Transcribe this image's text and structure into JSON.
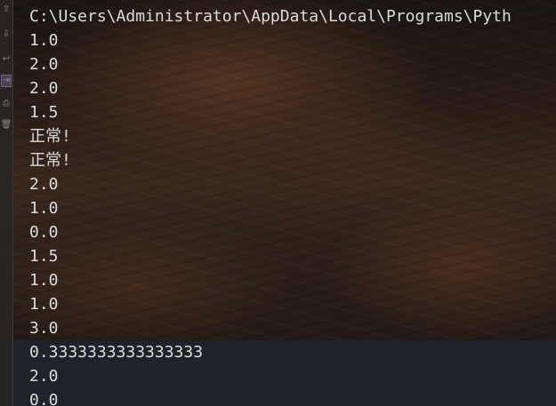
{
  "console": {
    "lines": [
      "C:\\Users\\Administrator\\AppData\\Local\\Programs\\Pyth",
      "1.0",
      "2.0",
      "2.0",
      "1.5",
      "正常!",
      "正常!",
      "2.0",
      "1.0",
      "0.0",
      "1.5",
      "1.0",
      "1.0",
      "3.0",
      "0.3333333333333333",
      "2.0",
      "0.0"
    ]
  },
  "gutter": {
    "icons": [
      {
        "name": "scroll-up-icon",
        "glyph": "⇧",
        "active": false
      },
      {
        "name": "scroll-down-icon",
        "glyph": "⇩",
        "active": false
      },
      {
        "name": "soft-wrap-icon",
        "glyph": "↩",
        "active": false
      },
      {
        "name": "scroll-to-end-icon",
        "glyph": "⇥",
        "active": true
      },
      {
        "name": "print-icon",
        "glyph": "⎙",
        "active": false
      },
      {
        "name": "trash-icon",
        "glyph": "🗑",
        "active": false
      }
    ]
  },
  "colors": {
    "text": "#dcdcdc",
    "gutter_icon": "#8a8a8a",
    "lower_band": "#1e2229"
  }
}
